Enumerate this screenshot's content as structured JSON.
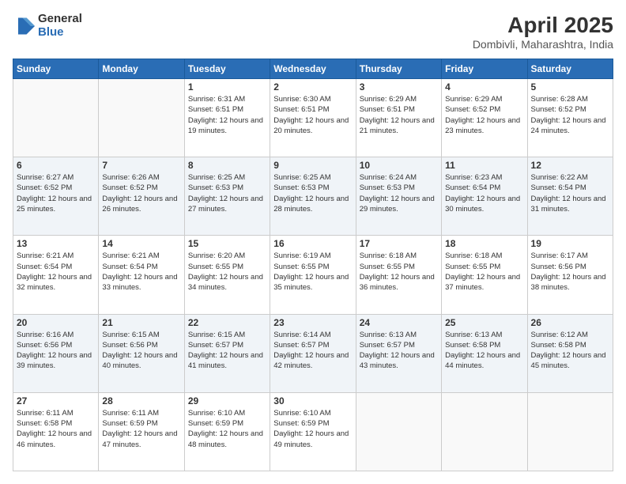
{
  "logo": {
    "general": "General",
    "blue": "Blue"
  },
  "title": "April 2025",
  "subtitle": "Dombivli, Maharashtra, India",
  "days_header": [
    "Sunday",
    "Monday",
    "Tuesday",
    "Wednesday",
    "Thursday",
    "Friday",
    "Saturday"
  ],
  "weeks": [
    [
      {
        "num": "",
        "info": ""
      },
      {
        "num": "",
        "info": ""
      },
      {
        "num": "1",
        "info": "Sunrise: 6:31 AM\nSunset: 6:51 PM\nDaylight: 12 hours and 19 minutes."
      },
      {
        "num": "2",
        "info": "Sunrise: 6:30 AM\nSunset: 6:51 PM\nDaylight: 12 hours and 20 minutes."
      },
      {
        "num": "3",
        "info": "Sunrise: 6:29 AM\nSunset: 6:51 PM\nDaylight: 12 hours and 21 minutes."
      },
      {
        "num": "4",
        "info": "Sunrise: 6:29 AM\nSunset: 6:52 PM\nDaylight: 12 hours and 23 minutes."
      },
      {
        "num": "5",
        "info": "Sunrise: 6:28 AM\nSunset: 6:52 PM\nDaylight: 12 hours and 24 minutes."
      }
    ],
    [
      {
        "num": "6",
        "info": "Sunrise: 6:27 AM\nSunset: 6:52 PM\nDaylight: 12 hours and 25 minutes."
      },
      {
        "num": "7",
        "info": "Sunrise: 6:26 AM\nSunset: 6:52 PM\nDaylight: 12 hours and 26 minutes."
      },
      {
        "num": "8",
        "info": "Sunrise: 6:25 AM\nSunset: 6:53 PM\nDaylight: 12 hours and 27 minutes."
      },
      {
        "num": "9",
        "info": "Sunrise: 6:25 AM\nSunset: 6:53 PM\nDaylight: 12 hours and 28 minutes."
      },
      {
        "num": "10",
        "info": "Sunrise: 6:24 AM\nSunset: 6:53 PM\nDaylight: 12 hours and 29 minutes."
      },
      {
        "num": "11",
        "info": "Sunrise: 6:23 AM\nSunset: 6:54 PM\nDaylight: 12 hours and 30 minutes."
      },
      {
        "num": "12",
        "info": "Sunrise: 6:22 AM\nSunset: 6:54 PM\nDaylight: 12 hours and 31 minutes."
      }
    ],
    [
      {
        "num": "13",
        "info": "Sunrise: 6:21 AM\nSunset: 6:54 PM\nDaylight: 12 hours and 32 minutes."
      },
      {
        "num": "14",
        "info": "Sunrise: 6:21 AM\nSunset: 6:54 PM\nDaylight: 12 hours and 33 minutes."
      },
      {
        "num": "15",
        "info": "Sunrise: 6:20 AM\nSunset: 6:55 PM\nDaylight: 12 hours and 34 minutes."
      },
      {
        "num": "16",
        "info": "Sunrise: 6:19 AM\nSunset: 6:55 PM\nDaylight: 12 hours and 35 minutes."
      },
      {
        "num": "17",
        "info": "Sunrise: 6:18 AM\nSunset: 6:55 PM\nDaylight: 12 hours and 36 minutes."
      },
      {
        "num": "18",
        "info": "Sunrise: 6:18 AM\nSunset: 6:55 PM\nDaylight: 12 hours and 37 minutes."
      },
      {
        "num": "19",
        "info": "Sunrise: 6:17 AM\nSunset: 6:56 PM\nDaylight: 12 hours and 38 minutes."
      }
    ],
    [
      {
        "num": "20",
        "info": "Sunrise: 6:16 AM\nSunset: 6:56 PM\nDaylight: 12 hours and 39 minutes."
      },
      {
        "num": "21",
        "info": "Sunrise: 6:15 AM\nSunset: 6:56 PM\nDaylight: 12 hours and 40 minutes."
      },
      {
        "num": "22",
        "info": "Sunrise: 6:15 AM\nSunset: 6:57 PM\nDaylight: 12 hours and 41 minutes."
      },
      {
        "num": "23",
        "info": "Sunrise: 6:14 AM\nSunset: 6:57 PM\nDaylight: 12 hours and 42 minutes."
      },
      {
        "num": "24",
        "info": "Sunrise: 6:13 AM\nSunset: 6:57 PM\nDaylight: 12 hours and 43 minutes."
      },
      {
        "num": "25",
        "info": "Sunrise: 6:13 AM\nSunset: 6:58 PM\nDaylight: 12 hours and 44 minutes."
      },
      {
        "num": "26",
        "info": "Sunrise: 6:12 AM\nSunset: 6:58 PM\nDaylight: 12 hours and 45 minutes."
      }
    ],
    [
      {
        "num": "27",
        "info": "Sunrise: 6:11 AM\nSunset: 6:58 PM\nDaylight: 12 hours and 46 minutes."
      },
      {
        "num": "28",
        "info": "Sunrise: 6:11 AM\nSunset: 6:59 PM\nDaylight: 12 hours and 47 minutes."
      },
      {
        "num": "29",
        "info": "Sunrise: 6:10 AM\nSunset: 6:59 PM\nDaylight: 12 hours and 48 minutes."
      },
      {
        "num": "30",
        "info": "Sunrise: 6:10 AM\nSunset: 6:59 PM\nDaylight: 12 hours and 49 minutes."
      },
      {
        "num": "",
        "info": ""
      },
      {
        "num": "",
        "info": ""
      },
      {
        "num": "",
        "info": ""
      }
    ]
  ]
}
